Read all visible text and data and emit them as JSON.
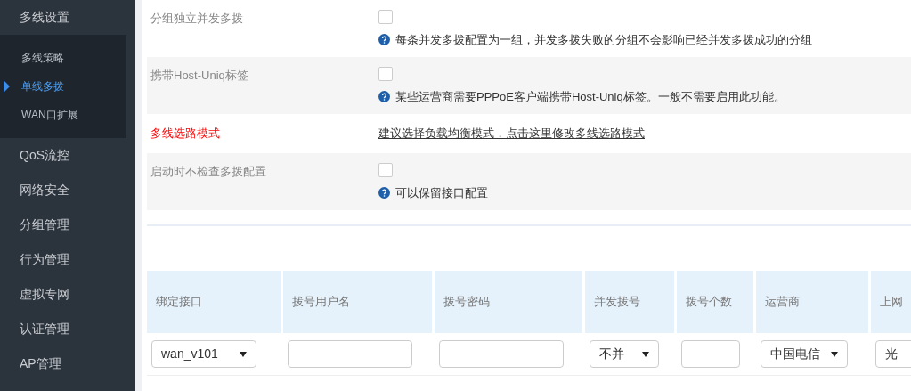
{
  "sidebar": {
    "items": [
      {
        "label": "多线设置",
        "expanded": true,
        "children": [
          {
            "label": "多线策略",
            "selected": false
          },
          {
            "label": "单线多拨",
            "selected": true
          },
          {
            "label": "WAN口扩展",
            "selected": false
          }
        ]
      },
      {
        "label": "QoS流控"
      },
      {
        "label": "网络安全"
      },
      {
        "label": "分组管理"
      },
      {
        "label": "行为管理"
      },
      {
        "label": "虚拟专网"
      },
      {
        "label": "认证管理"
      },
      {
        "label": "AP管理"
      }
    ]
  },
  "settings": [
    {
      "kind": "checkbox",
      "label": "分组独立并发多拨",
      "checked": false,
      "help": "每条并发多拨配置为一组，并发多拨失败的分组不会影响已经并发多拨成功的分组"
    },
    {
      "kind": "checkbox",
      "label": "携带Host-Uniq标签",
      "checked": false,
      "help": "某些运营商需要PPPoE客户端携带Host-Uniq标签。一般不需要启用此功能。"
    },
    {
      "kind": "link",
      "label": "多线选路模式",
      "link": "建议选择负载均衡模式，点击这里修改多线选路模式"
    },
    {
      "kind": "checkbox",
      "label": "启动时不检查多拨配置",
      "checked": false,
      "help": "可以保留接口配置"
    }
  ],
  "table": {
    "columns": [
      "绑定接口",
      "拨号用户名",
      "拨号密码",
      "并发拨号",
      "拨号个数",
      "运营商",
      "上网"
    ],
    "rows": [
      [
        {
          "kind": "select",
          "value": "wan_v101"
        },
        {
          "kind": "input"
        },
        {
          "kind": "input"
        },
        {
          "kind": "select",
          "value": "不并"
        },
        {
          "kind": "input"
        },
        {
          "kind": "select",
          "value": "中国电信"
        },
        {
          "kind": "select",
          "value": "光"
        }
      ]
    ]
  }
}
